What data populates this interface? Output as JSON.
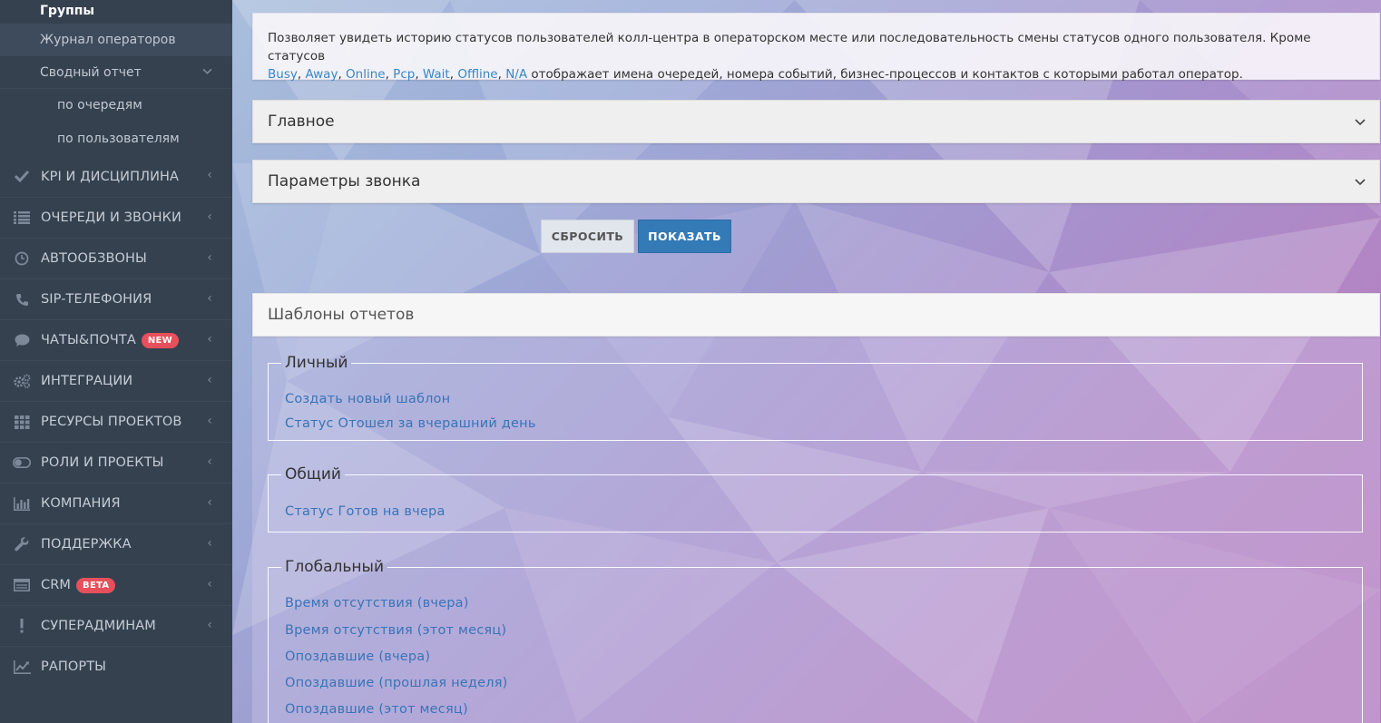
{
  "sidebar": {
    "groups_label": "Группы",
    "operators_log": "Журнал операторов",
    "summary_report": "Сводный отчет",
    "by_queues": "по очередям",
    "by_users": "по пользователям",
    "items": [
      {
        "label": "KPI И ДИСЦИПЛИНА",
        "icon": "check-icon"
      },
      {
        "label": "ОЧЕРЕДИ И ЗВОНКИ",
        "icon": "list-icon"
      },
      {
        "label": "АВТООБЗВОНЫ",
        "icon": "clock-icon"
      },
      {
        "label": "SIP-ТЕЛЕФОНИЯ",
        "icon": "phone-icon"
      },
      {
        "label": "ЧАТЫ&ПОЧТА",
        "icon": "chat-icon",
        "badge": "NEW"
      },
      {
        "label": "ИНТЕГРАЦИИ",
        "icon": "gears-icon"
      },
      {
        "label": "РЕСУРСЫ ПРОЕКТОВ",
        "icon": "grid-icon"
      },
      {
        "label": "РОЛИ И ПРОЕКТЫ",
        "icon": "toggle-icon"
      },
      {
        "label": "КОМПАНИЯ",
        "icon": "bar-chart-icon"
      },
      {
        "label": "ПОДДЕРЖКА",
        "icon": "wrench-icon"
      },
      {
        "label": "CRM",
        "icon": "table-icon",
        "badge": "BETA"
      },
      {
        "label": "СУПЕРАДМИНАМ",
        "icon": "exclamation-icon"
      },
      {
        "label": "РАПОРТЫ",
        "icon": "line-chart-icon"
      }
    ]
  },
  "info": {
    "text_before": "Позволяет увидеть историю статусов пользователей колл-центра в операторском месте или последовательность смены статусов одного пользователя. Кроме статусов",
    "statuses": [
      "Busy",
      "Away",
      "Online",
      "Pcp",
      "Wait",
      "Offline",
      "N/A"
    ],
    "text_after": "отображает имена очередей, номера событий, бизнес-процессов и контактов с которыми работал оператор."
  },
  "accordions": {
    "main": "Главное",
    "call_params": "Параметры звонка"
  },
  "buttons": {
    "reset": "СБРОСИТЬ",
    "show": "ПОКАЗАТЬ"
  },
  "templates": {
    "title": "Шаблоны отчетов",
    "personal": {
      "legend": "Личный",
      "links": [
        "Создать новый шаблон",
        "Статус Отошел за вчерашний день"
      ]
    },
    "common": {
      "legend": "Общий",
      "links": [
        "Статус Готов на вчера"
      ]
    },
    "global": {
      "legend": "Глобальный",
      "links": [
        "Время отсутствия (вчера)",
        "Время отсутствия (этот месяц)",
        "Опоздавшие (вчера)",
        "Опоздавшие (прошлая неделя)",
        "Опоздавшие (этот месяц)"
      ]
    }
  },
  "colors": {
    "sidebar_bg": "#364150",
    "link": "#3a86c4",
    "primary_button": "#337ab7",
    "badge": "#e7505a"
  }
}
